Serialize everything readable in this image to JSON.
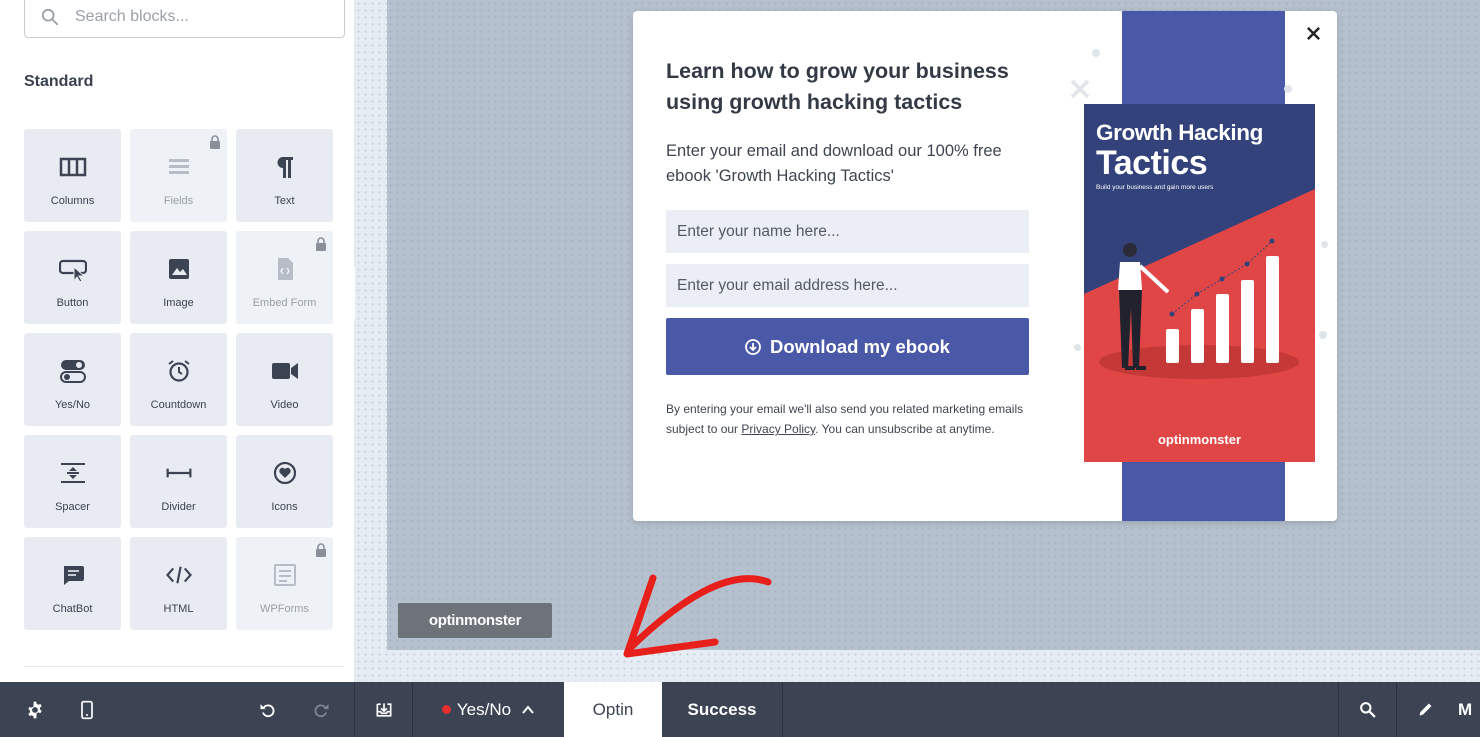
{
  "sidebar": {
    "search_placeholder": "Search blocks...",
    "section_title": "Standard",
    "blocks": [
      {
        "label": "Columns",
        "icon": "columns-icon",
        "locked": false
      },
      {
        "label": "Fields",
        "icon": "fields-icon",
        "locked": true
      },
      {
        "label": "Text",
        "icon": "pilcrow-icon",
        "locked": false
      },
      {
        "label": "Button",
        "icon": "button-cursor-icon",
        "locked": false
      },
      {
        "label": "Image",
        "icon": "image-icon",
        "locked": false
      },
      {
        "label": "Embed Form",
        "icon": "embed-form-icon",
        "locked": true
      },
      {
        "label": "Yes/No",
        "icon": "yes-no-toggle-icon",
        "locked": false
      },
      {
        "label": "Countdown",
        "icon": "alarm-clock-icon",
        "locked": false
      },
      {
        "label": "Video",
        "icon": "video-camera-icon",
        "locked": false
      },
      {
        "label": "Spacer",
        "icon": "spacer-icon",
        "locked": false
      },
      {
        "label": "Divider",
        "icon": "divider-icon",
        "locked": false
      },
      {
        "label": "Icons",
        "icon": "heart-circle-icon",
        "locked": false
      },
      {
        "label": "ChatBot",
        "icon": "chat-bubble-icon",
        "locked": false
      },
      {
        "label": "HTML",
        "icon": "code-icon",
        "locked": false
      },
      {
        "label": "WPForms",
        "icon": "wpforms-icon",
        "locked": true
      }
    ]
  },
  "popup": {
    "headline": "Learn how to grow your business using growth hacking tactics",
    "description": "Enter your email and download our 100% free ebook 'Growth Hacking Tactics'",
    "name_placeholder": "Enter your name here...",
    "email_placeholder": "Enter your email address here...",
    "cta_label": "Download my ebook",
    "fine_print_before": "By entering your email we'll also send you related marketing emails subject to our ",
    "privacy_link": "Privacy Policy",
    "fine_print_after": ". You can unsubscribe at anytime.",
    "book": {
      "title_line1": "Growth Hacking",
      "title_line2": "Tactics",
      "subtitle": "Build your business and gain more users",
      "logo": "optinmonster"
    }
  },
  "canvas": {
    "badge": "optinmonster"
  },
  "bottombar": {
    "yes_no_label": "Yes/No",
    "tab_optin": "Optin",
    "tab_success": "Success",
    "right_partial": "M"
  },
  "colors": {
    "accent": "#4a58a8",
    "bar": "#3c4454",
    "book_red": "#e04646",
    "book_navy": "#33427a",
    "record_dot": "#e52e2e",
    "annotation_arrow": "#e8201c"
  }
}
